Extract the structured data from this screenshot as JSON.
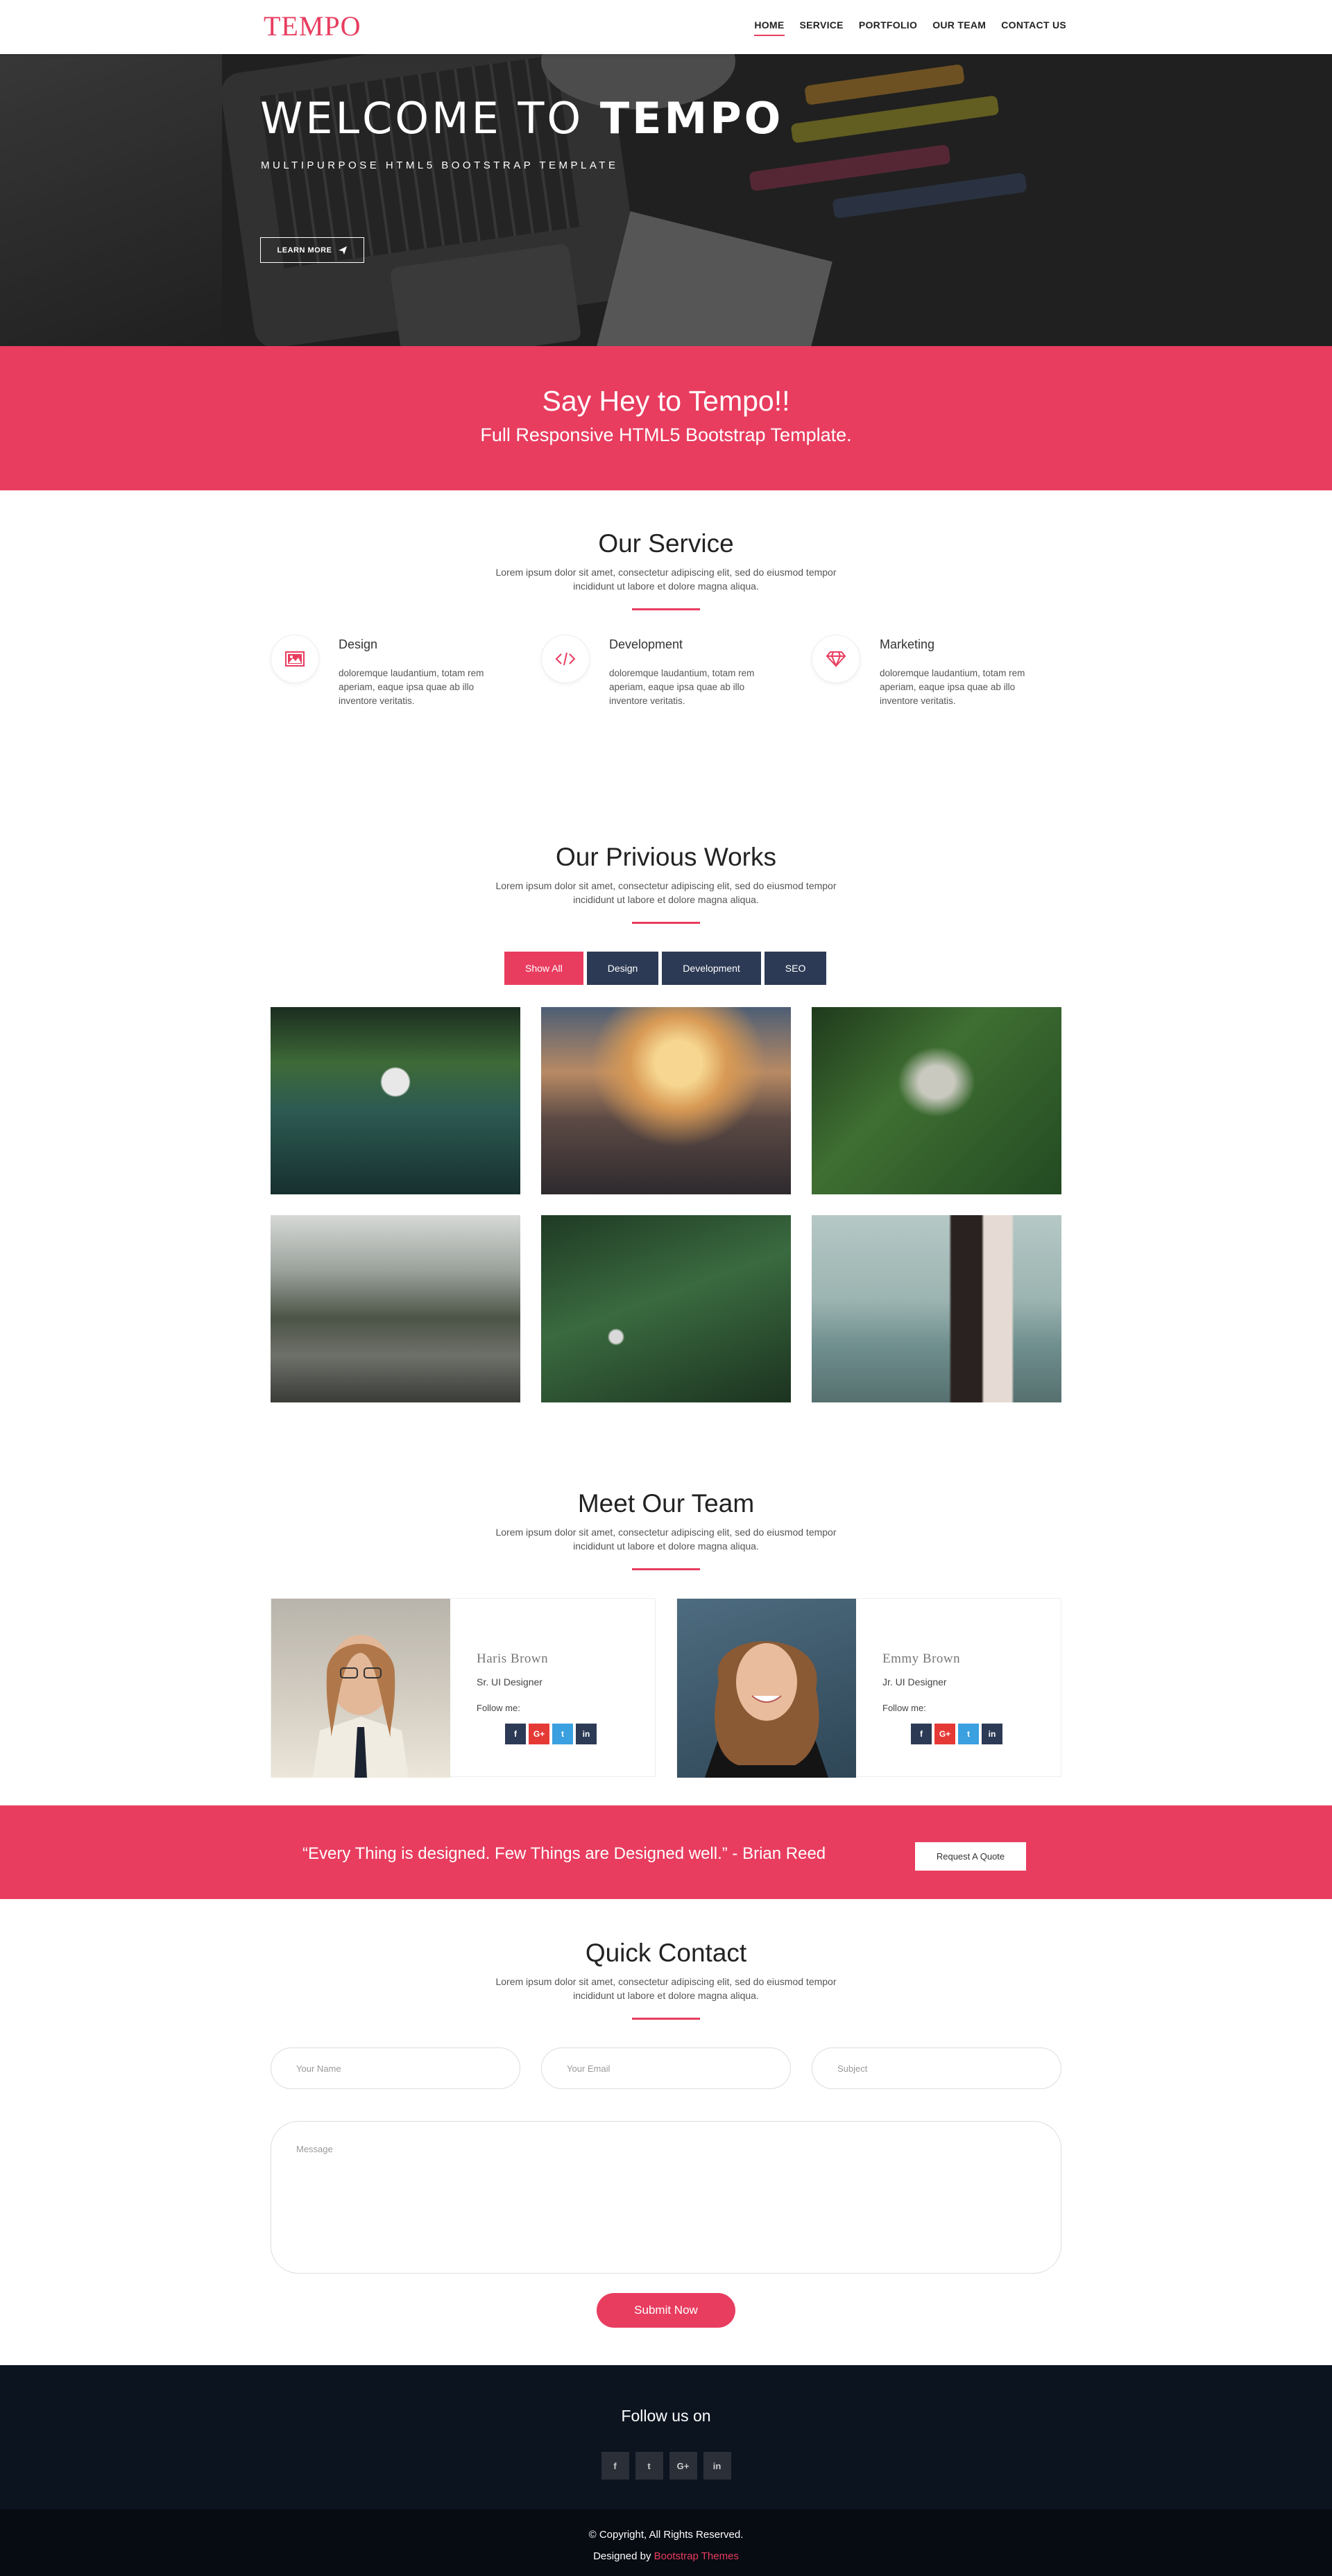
{
  "nav": {
    "logo": "TEMPO",
    "items": [
      "HOME",
      "SERVICE",
      "PORTFOLIO",
      "OUR TEAM",
      "CONTACT US"
    ]
  },
  "hero": {
    "title_light": "WELCOME TO ",
    "title_bold": "TEMPO",
    "subtitle": "MULTIPURPOSE HTML5 BOOTSTRAP TEMPLATE",
    "button": "LEARN MORE"
  },
  "banner": {
    "title": "Say Hey to Tempo!!",
    "subtitle": "Full Responsive HTML5 Bootstrap Template."
  },
  "lorem": {
    "line1": "Lorem ipsum dolor sit amet, consectetur adipiscing elit, sed do eiusmod tempor",
    "line2": "incididunt ut labore et dolore magna aliqua."
  },
  "service": {
    "title": "Our Service",
    "items": [
      {
        "title": "Design",
        "text": "doloremque laudantium, totam rem aperiam, eaque ipsa quae ab illo inventore veritatis.",
        "icon": "image-icon"
      },
      {
        "title": "Development",
        "text": "doloremque laudantium, totam rem aperiam, eaque ipsa quae ab illo inventore veritatis.",
        "icon": "code-icon"
      },
      {
        "title": "Marketing",
        "text": "doloremque laudantium, totam rem aperiam, eaque ipsa quae ab illo inventore veritatis.",
        "icon": "diamond-icon"
      }
    ]
  },
  "works": {
    "title": "Our Privious Works",
    "filters": [
      "Show All",
      "Design",
      "Development",
      "SEO"
    ],
    "active_filter": "Show All"
  },
  "team": {
    "title": "Meet Our Team",
    "follow": "Follow me:",
    "members": [
      {
        "name": "Haris Brown",
        "role": "Sr. UI Designer"
      },
      {
        "name": "Emmy Brown",
        "role": "Jr. UI Designer"
      }
    ],
    "social": [
      "f",
      "G+",
      "t",
      "in"
    ]
  },
  "quote": {
    "text": "“Every Thing is designed. Few Things are Designed well.” - Brian Reed",
    "button": "Request A Quote"
  },
  "contact": {
    "title": "Quick Contact",
    "name_placeholder": "Your Name",
    "email_placeholder": "Your Email",
    "subject_placeholder": "Subject",
    "message_placeholder": "Message",
    "submit": "Submit Now"
  },
  "footer": {
    "follow": "Follow us on",
    "social": [
      "f",
      "t",
      "G+",
      "in"
    ],
    "copyright": "© Copyright, All Rights Reserved.",
    "designed_by": "Designed by ",
    "designer": "Bootstrap Themes"
  },
  "colors": {
    "accent": "#e83d5f",
    "navy": "#2c3a55",
    "footer": "#0c1420"
  }
}
